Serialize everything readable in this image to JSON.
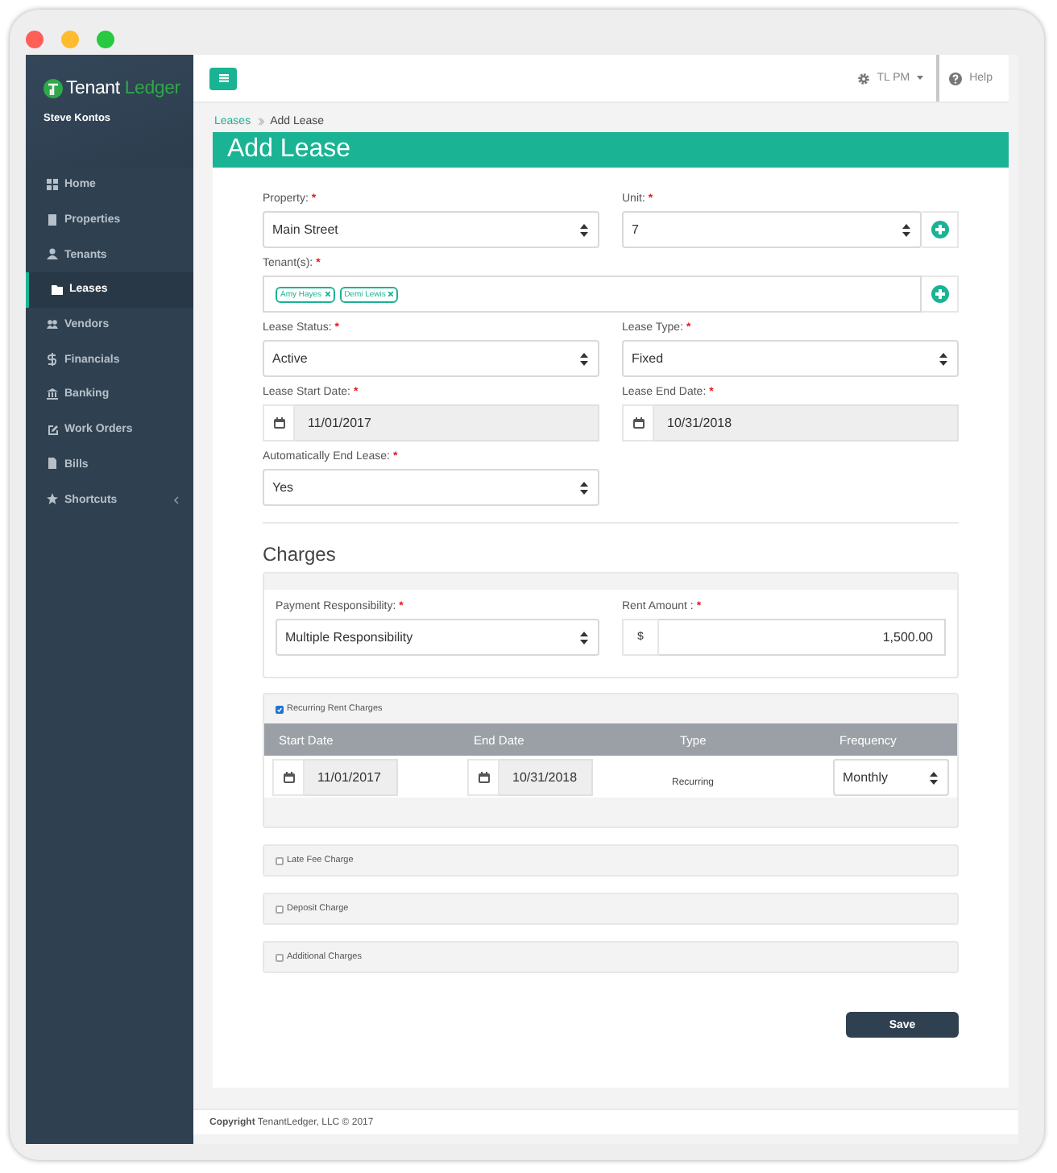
{
  "sidebar": {
    "brand": {
      "name": "Tenant",
      "accent": "Ledger"
    },
    "user": "Steve Kontos",
    "items": [
      {
        "label": "Home",
        "selected": false
      },
      {
        "label": "Properties",
        "selected": false
      },
      {
        "label": "Tenants",
        "selected": false
      },
      {
        "label": "Leases",
        "selected": true
      },
      {
        "label": "Vendors",
        "selected": false
      },
      {
        "label": "Financials",
        "selected": false
      },
      {
        "label": "Banking",
        "selected": false
      },
      {
        "label": "Work Orders",
        "selected": false
      },
      {
        "label": "Bills",
        "selected": false
      },
      {
        "label": "Shortcuts",
        "selected": false,
        "expandable": true
      }
    ]
  },
  "topbar": {
    "user_menu": "TL PM",
    "help": "Help"
  },
  "breadcrumb": [
    {
      "label": "Leases",
      "kind": "link"
    },
    {
      "label": "Add Lease",
      "kind": "current"
    }
  ],
  "page_title": "Add Lease",
  "fields": [
    {
      "kind": "select",
      "label": "Property:",
      "required_mark": "*",
      "value": "Main Street"
    },
    {
      "kind": "select",
      "label": "Unit:",
      "required_mark": "*",
      "value": "7",
      "add_button": true
    },
    {
      "kind": "tags",
      "label": "Tenant(s):",
      "required_mark": "*",
      "tags": [
        "Amy Hayes",
        "Demi Lewis"
      ],
      "add_button": true
    },
    {
      "kind": "select",
      "label": "Lease Status:",
      "required_mark": "*",
      "value": "Active"
    },
    {
      "kind": "select",
      "label": "Lease Type:",
      "required_mark": "*",
      "value": "Fixed"
    },
    {
      "kind": "date",
      "label": "Lease Start Date:",
      "required_mark": "*",
      "value": "11/01/2017"
    },
    {
      "kind": "date",
      "label": "Lease End Date:",
      "required_mark": "*",
      "value": "10/31/2018"
    },
    {
      "kind": "select",
      "label": "Automatically End Lease:",
      "required_mark": "*",
      "value": "Yes"
    }
  ],
  "charges": {
    "title": "Charges",
    "payment_responsibility": {
      "label": "Payment Responsibility:",
      "required_mark": "*",
      "value": "Multiple Responsibility"
    },
    "rent_amount": {
      "label": "Rent Amount :",
      "required_mark": "*",
      "prefix": "$",
      "value": "1,500.00"
    }
  },
  "recurring": {
    "label": "Recurring Rent Charges",
    "checked": true,
    "columns": [
      "Start Date",
      "End Date",
      "Type",
      "Frequency"
    ],
    "row": {
      "start": "11/01/2017",
      "end": "10/31/2018",
      "type": "Recurring",
      "frequency": "Monthly"
    }
  },
  "charge_panels": [
    {
      "label": "Late Fee Charge",
      "checked": false
    },
    {
      "label": "Deposit Charge",
      "checked": false
    },
    {
      "label": "Additional Charges",
      "checked": false
    }
  ],
  "save_button": "Save",
  "footer": "**Copyright** TenantLedger, LLC © 2017"
}
